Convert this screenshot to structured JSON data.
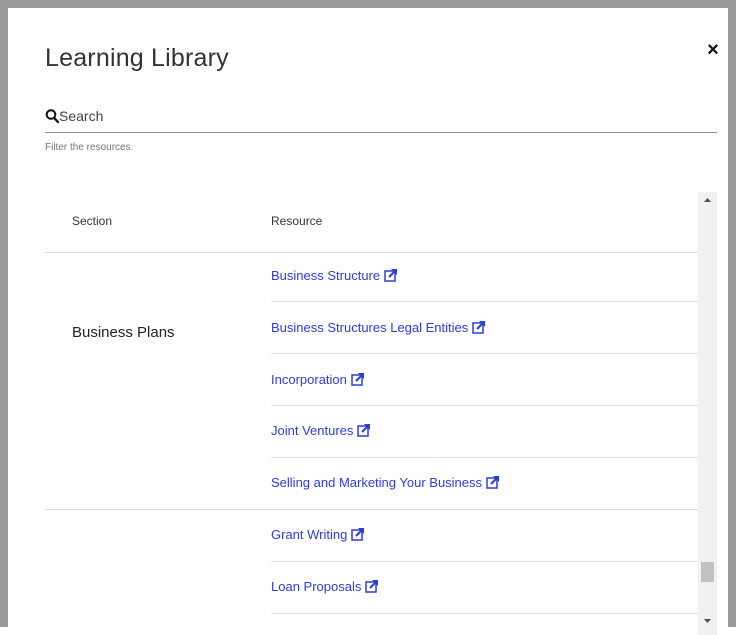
{
  "dialog": {
    "title": "Learning Library",
    "close_glyph": "×"
  },
  "search": {
    "placeholder": "Search",
    "value": "",
    "hint": "Filter the resources."
  },
  "table": {
    "headers": [
      "Section",
      "Resource"
    ],
    "groups": [
      {
        "section": "Business Plans",
        "resources": [
          "Business Structure",
          "Business Structures Legal Entities",
          "Incorporation",
          "Joint Ventures",
          "Selling and Marketing Your Business"
        ]
      },
      {
        "section": "",
        "resources": [
          "Grant Writing",
          "Loan Proposals"
        ]
      }
    ]
  },
  "icons": {
    "search": "search-icon",
    "external_link": "external-link-icon",
    "close": "close-icon"
  },
  "colors": {
    "link": "#2b3fd6",
    "frame": "#9a9a9a",
    "scrollbar_track": "#f1f1f1",
    "scrollbar_thumb": "#c1c1c1"
  }
}
